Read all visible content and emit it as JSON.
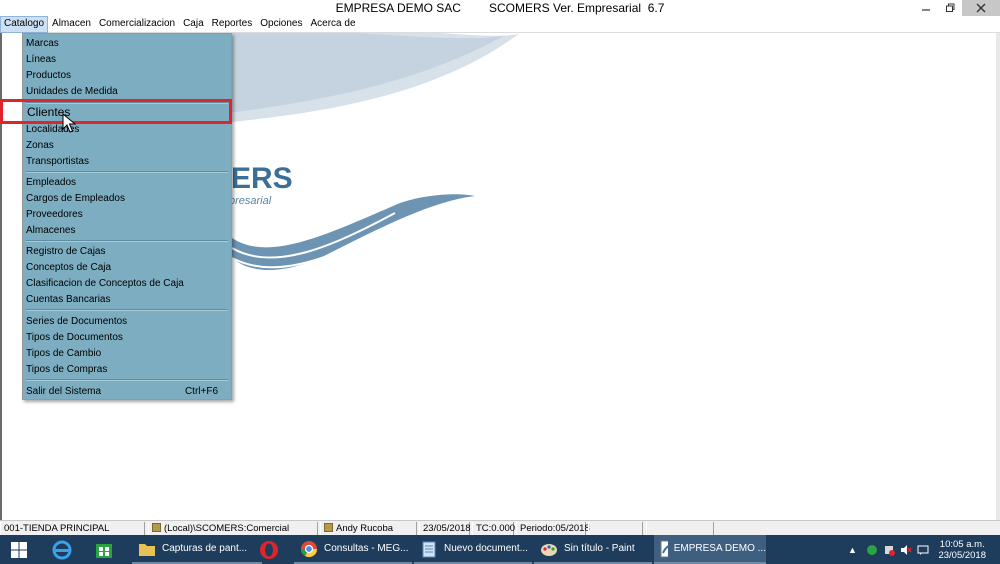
{
  "window": {
    "company": "EMPRESA DEMO SAC",
    "product": "SCOMERS Ver. Empresarial  6.7",
    "minimize_icon": "minimize-icon",
    "restore_icon": "restore-icon",
    "close_icon": "close-icon"
  },
  "menubar": [
    "Catalogo",
    "Almacen",
    "Comercializacion",
    "Caja",
    "Reportes",
    "Opciones",
    "Acerca de"
  ],
  "logo": {
    "text": "ERS",
    "subtitle": "presarial"
  },
  "dropdown": {
    "items": [
      {
        "label": "Marcas"
      },
      {
        "label": "Líneas"
      },
      {
        "label": "Productos"
      },
      {
        "label": "Unidades de Medida"
      },
      {
        "label": "Clientes"
      },
      {
        "label": "Localidades"
      },
      {
        "label": "Zonas"
      },
      {
        "label": "Transportistas"
      },
      {
        "label": "Empleados"
      },
      {
        "label": "Cargos de Empleados"
      },
      {
        "label": "Proveedores"
      },
      {
        "label": "Almacenes"
      },
      {
        "label": "Registro de Cajas"
      },
      {
        "label": "Conceptos de Caja"
      },
      {
        "label": "Clasificacion de Conceptos de Caja"
      },
      {
        "label": "Cuentas Bancarias"
      },
      {
        "label": "Series de Documentos"
      },
      {
        "label": "Tipos de Documentos"
      },
      {
        "label": "Tipos de Cambio"
      },
      {
        "label": "Tipos de Compras"
      },
      {
        "label": "Salir del Sistema",
        "shortcut": "Ctrl+F6"
      }
    ]
  },
  "statusbar": {
    "store": "001-TIENDA PRINCIPAL",
    "db": "(Local)\\SCOMERS:Comercial",
    "user": "Andy Rucoba",
    "date": "23/05/2018",
    "tc": "TC:0.000",
    "period": "Periodo:05/2018"
  },
  "taskbar": {
    "apps": [
      {
        "label": "Capturas de pant...",
        "icon": "folder-icon"
      },
      {
        "label": "Consultas - MEG...",
        "icon": "chrome-icon"
      },
      {
        "label": "Nuevo document...",
        "icon": "notepad-icon"
      },
      {
        "label": "Sin título - Paint",
        "icon": "paint-icon"
      },
      {
        "label": "EMPRESA DEMO ...",
        "icon": "scomers-icon"
      }
    ],
    "time": "10:05 a.m.",
    "date": "23/05/2018",
    "colors": {
      "taskbar": "#1e3d5c",
      "active": "#3e5f80",
      "highlight": "#e0242b",
      "menu_bg": "#7dadc1"
    }
  }
}
